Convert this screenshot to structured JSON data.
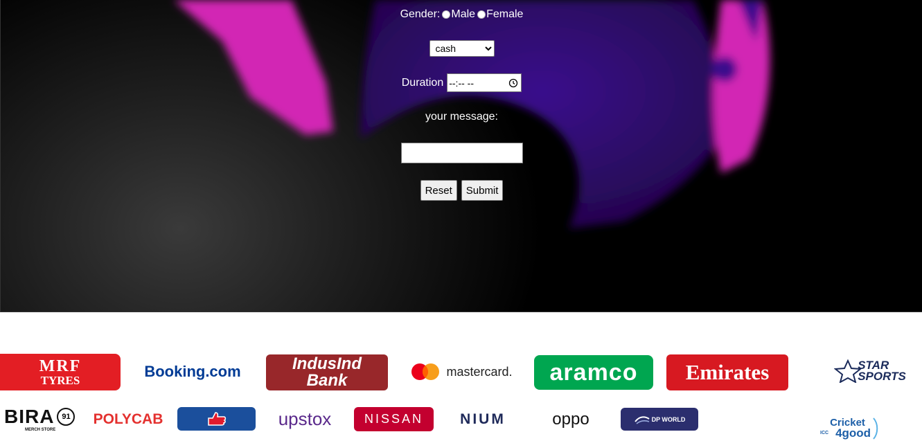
{
  "form": {
    "gender_label": "Gender:",
    "gender_options": [
      "Male",
      "Female"
    ],
    "payment_selected": "cash",
    "duration_label": "Duration",
    "duration_value": "--:-- --",
    "message_label": "your message:",
    "message_value": "",
    "reset_label": "Reset",
    "submit_label": "Submit"
  },
  "sponsors": {
    "mrf_top": "MRF",
    "mrf_bottom": "TYRES",
    "booking": "Booking.com",
    "indusind_top": "IndusInd",
    "indusind_bottom": "Bank",
    "mastercard": "mastercard.",
    "aramco": "aramco",
    "emirates": "Emirates",
    "star_top": "STAR",
    "star_bottom": "SPORTS",
    "bira": "BIRA",
    "bira_badge": "91",
    "bira_sub": "MERCH STORE",
    "polycab": "POLYCAB",
    "upstox": "upstox",
    "nissan": "NISSAN",
    "nium": "NIUM",
    "oppo": "oppo",
    "dpworld": "DP WORLD",
    "cricket_top": "Cricket",
    "cricket_bottom": "4good",
    "cricket_icc": "ICC"
  },
  "colors": {
    "mrf_red": "#e31e24",
    "booking_blue": "#003b95",
    "indusind_maroon": "#98272a",
    "aramco_green": "#00a650",
    "emirates_red": "#d71921",
    "polycab_red": "#e4312f",
    "thumbsup_blue": "#1b4f9c",
    "upstox_purple": "#5a298b",
    "nissan_red": "#c3002f",
    "nium_navy": "#1f2a5a",
    "dpworld_navy": "#2b2e6e",
    "cricket_blue": "#1d5fa8",
    "magenta": "#e834c8",
    "purple": "#4a0c9a"
  }
}
